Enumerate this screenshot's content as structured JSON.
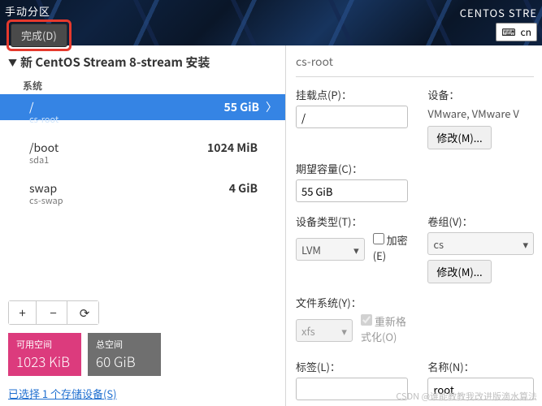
{
  "topbar": {
    "title": "手动分区",
    "done_label": "完成(D)",
    "product": "CENTOS STRE",
    "keyboard": "cn"
  },
  "left": {
    "install_title": "新 CentOS Stream 8-stream 安装",
    "system_label": "系统",
    "partitions": [
      {
        "mount": "/",
        "device": "cs-root",
        "size": "55 GiB",
        "selected": true
      },
      {
        "mount": "/boot",
        "device": "sda1",
        "size": "1024 MiB",
        "selected": false
      },
      {
        "mount": "swap",
        "device": "cs-swap",
        "size": "4 GiB",
        "selected": false
      }
    ],
    "add_label": "+",
    "remove_label": "−",
    "reload_label": "⟳",
    "available": {
      "label": "可用空间",
      "value": "1023 KiB"
    },
    "total": {
      "label": "总空间",
      "value": "60 GiB"
    },
    "storage_link": "已选择 1 个存储设备(S)"
  },
  "right": {
    "title": "cs-root",
    "mount_label": "挂载点(P)：",
    "mount_value": "/",
    "device_label": "设备：",
    "device_value": "VMware, VMware V",
    "modify_label": "修改(M)...",
    "capacity_label": "期望容量(C)：",
    "capacity_value": "55 GiB",
    "devtype_label": "设备类型(T)：",
    "devtype_value": "LVM",
    "encrypt_label": "加密(E)",
    "vg_label": "卷组(V)：",
    "vg_value": "cs",
    "fs_label": "文件系统(Y)：",
    "fs_value": "xfs",
    "reformat_label": "重新格式化(O)",
    "tag_label": "标签(L)：",
    "tag_value": "",
    "name_label": "名称(N)：",
    "name_value": "root"
  },
  "watermark": "CSDN @谁能教教我改进版滴水算法"
}
